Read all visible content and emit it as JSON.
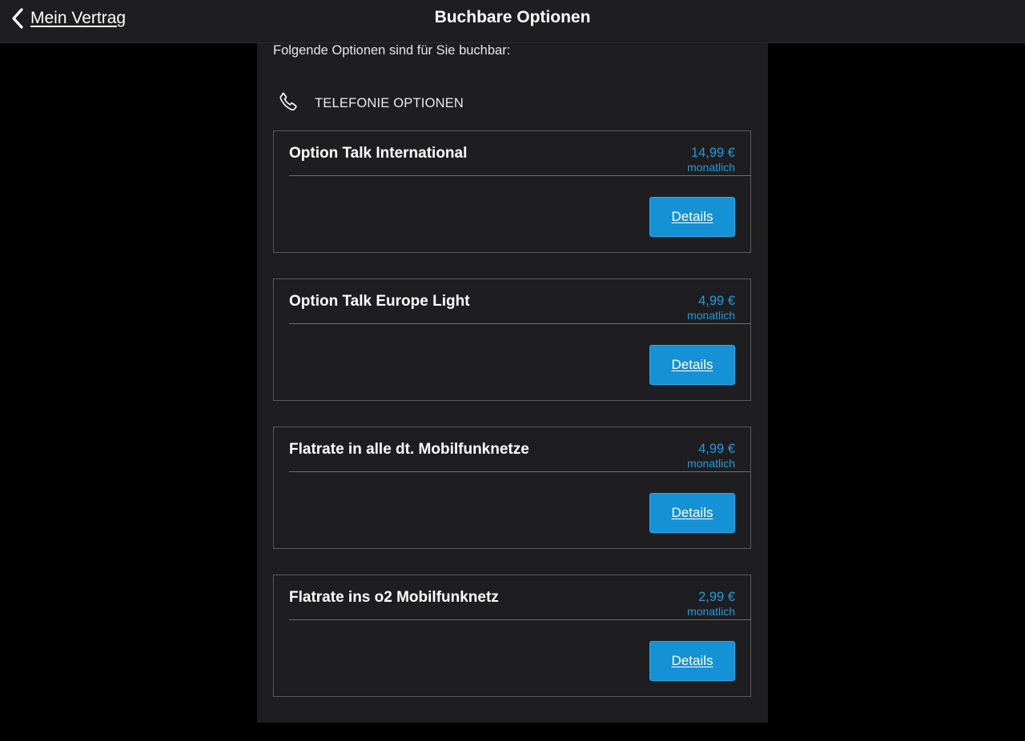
{
  "header": {
    "back_label": "Mein Vertrag",
    "title": "Buchbare Optionen"
  },
  "content": {
    "intro": "Folgende Optionen sind für Sie buchbar:",
    "section_label": "TELEFONIE OPTIONEN",
    "details_label": "Details",
    "options": [
      {
        "name": "Option Talk International",
        "price": "14,99 €",
        "period": "monatlich"
      },
      {
        "name": "Option Talk Europe Light",
        "price": "4,99 €",
        "period": "monatlich"
      },
      {
        "name": "Flatrate in alle dt. Mobilfunknetze",
        "price": "4,99 €",
        "period": "monatlich"
      },
      {
        "name": "Flatrate ins o2 Mobilfunknetz",
        "price": "2,99 €",
        "period": "monatlich"
      }
    ]
  },
  "icons": {
    "back": "chevron-left-icon",
    "section": "phone-icon"
  },
  "colors": {
    "background": "#000000",
    "surface": "#1e1e20",
    "accent": "#1591d6",
    "price_text": "#1e9be0",
    "border": "#5a5a5c"
  }
}
